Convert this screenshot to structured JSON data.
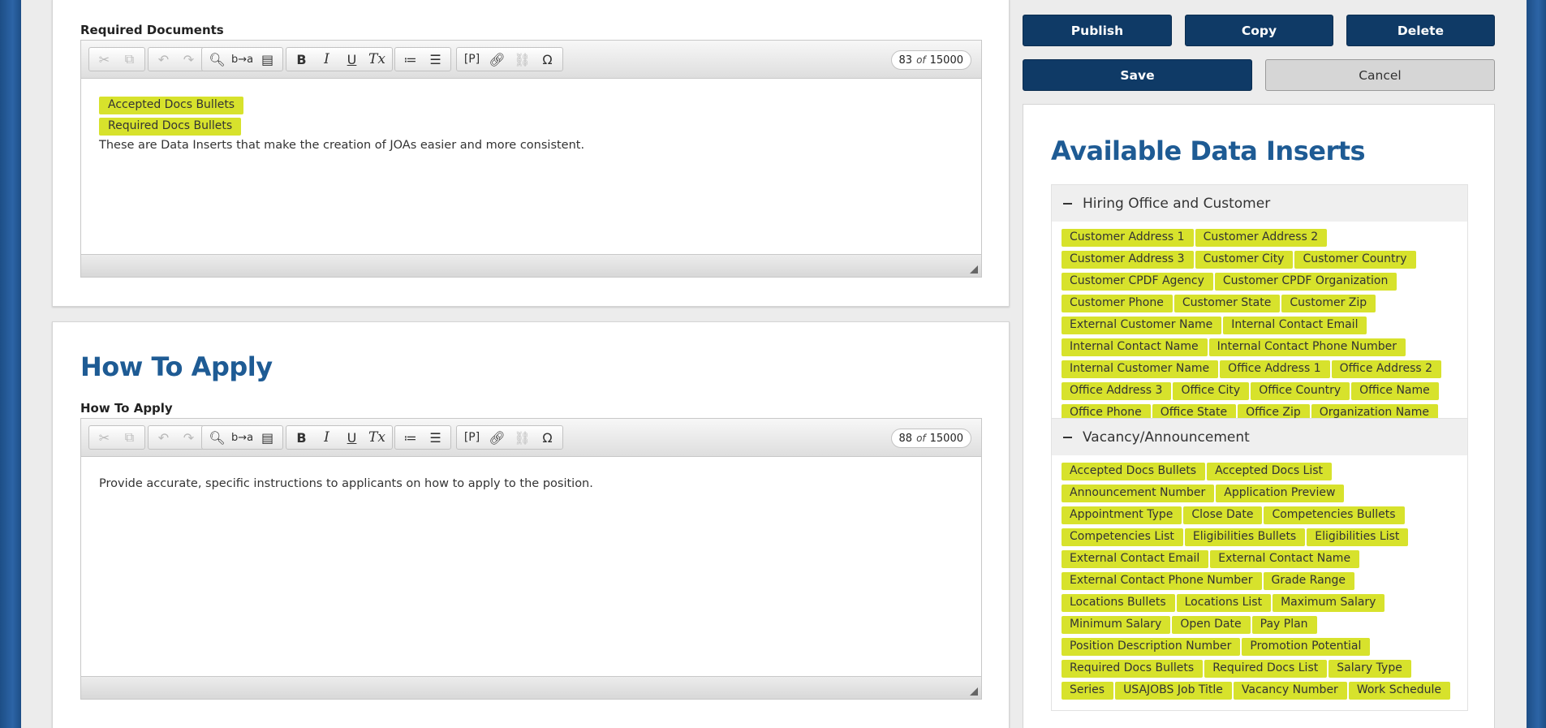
{
  "colors": {
    "accent_blue": "#1e5b94",
    "button_navy": "#0f3a66",
    "chip_yellow": "#d7e22c",
    "page_edge_blue": "#2c64a6"
  },
  "required_documents": {
    "label": "Required Documents",
    "counter": {
      "current": "83",
      "of": "of",
      "max": "15000"
    },
    "chips": [
      "Accepted Docs Bullets",
      "Required Docs Bullets"
    ],
    "text": "These are Data Inserts that make the creation of JOAs easier and more consistent."
  },
  "how_to_apply": {
    "section_title": "How To Apply",
    "label": "How To Apply",
    "counter": {
      "current": "88",
      "of": "of",
      "max": "15000"
    },
    "text": "Provide accurate, specific instructions to applicants on how to apply to the position."
  },
  "toolbar_icons": [
    "cut-icon",
    "copy-icon",
    "undo-icon",
    "redo-icon",
    "find-icon",
    "replace-icon",
    "select-all-icon",
    "bold-icon",
    "italic-icon",
    "underline-icon",
    "remove-format-icon",
    "numbered-list-icon",
    "bulleted-list-icon",
    "paragraph-icon",
    "link-icon",
    "unlink-icon",
    "special-char-icon"
  ],
  "toolbar_glyphs": {
    "bold": "B",
    "italic": "I",
    "underline": "U",
    "remove_format": "Tx",
    "paragraph": "[P]",
    "special_char": "Ω"
  },
  "actions": {
    "publish": "Publish",
    "copy": "Copy",
    "delete": "Delete",
    "save": "Save",
    "cancel": "Cancel"
  },
  "data_inserts": {
    "title": "Available Data Inserts",
    "groups": [
      {
        "name": "Hiring Office and Customer",
        "items": [
          "Customer Address 1",
          "Customer Address 2",
          "Customer Address 3",
          "Customer City",
          "Customer Country",
          "Customer CPDF Agency",
          "Customer CPDF Organization",
          "Customer Phone",
          "Customer State",
          "Customer Zip",
          "External Customer Name",
          "Internal Contact Email",
          "Internal Contact Name",
          "Internal Contact Phone Number",
          "Internal Customer Name",
          "Office Address 1",
          "Office Address 2",
          "Office Address 3",
          "Office City",
          "Office Country",
          "Office Name",
          "Office Phone",
          "Office State",
          "Office Zip",
          "Organization Name"
        ]
      },
      {
        "name": "Vacancy/Announcement",
        "items": [
          "Accepted Docs Bullets",
          "Accepted Docs List",
          "Announcement Number",
          "Application Preview",
          "Appointment Type",
          "Close Date",
          "Competencies Bullets",
          "Competencies List",
          "Eligibilities Bullets",
          "Eligibilities List",
          "External Contact Email",
          "External Contact Name",
          "External Contact Phone Number",
          "Grade Range",
          "Locations Bullets",
          "Locations List",
          "Maximum Salary",
          "Minimum Salary",
          "Open Date",
          "Pay Plan",
          "Position Description Number",
          "Promotion Potential",
          "Required Docs Bullets",
          "Required Docs List",
          "Salary Type",
          "Series",
          "USAJOBS Job Title",
          "Vacancy Number",
          "Work Schedule"
        ]
      }
    ]
  }
}
